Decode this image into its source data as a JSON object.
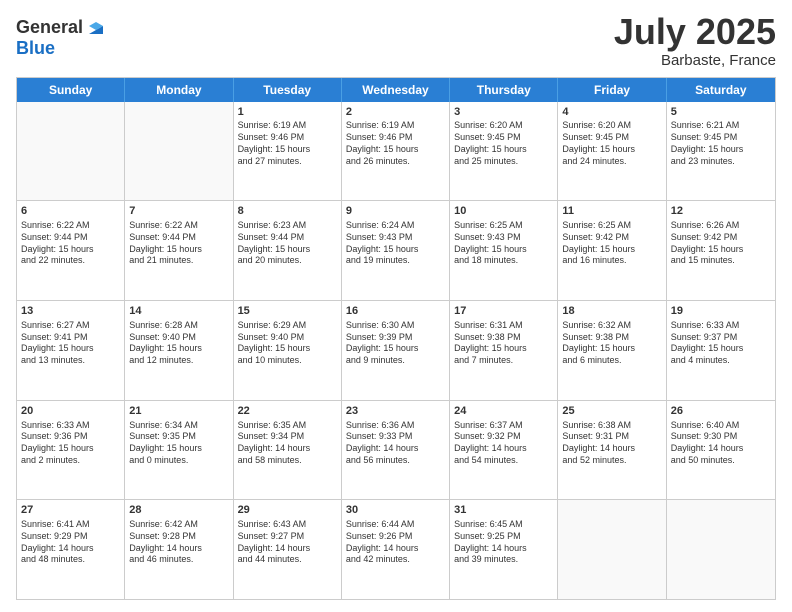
{
  "header": {
    "logo": {
      "line1": "General",
      "line2": "Blue"
    },
    "title": "July 2025",
    "subtitle": "Barbaste, France"
  },
  "weekdays": [
    "Sunday",
    "Monday",
    "Tuesday",
    "Wednesday",
    "Thursday",
    "Friday",
    "Saturday"
  ],
  "rows": [
    [
      {
        "day": "",
        "empty": true
      },
      {
        "day": "",
        "empty": true
      },
      {
        "day": "1",
        "l1": "Sunrise: 6:19 AM",
        "l2": "Sunset: 9:46 PM",
        "l3": "Daylight: 15 hours",
        "l4": "and 27 minutes."
      },
      {
        "day": "2",
        "l1": "Sunrise: 6:19 AM",
        "l2": "Sunset: 9:46 PM",
        "l3": "Daylight: 15 hours",
        "l4": "and 26 minutes."
      },
      {
        "day": "3",
        "l1": "Sunrise: 6:20 AM",
        "l2": "Sunset: 9:45 PM",
        "l3": "Daylight: 15 hours",
        "l4": "and 25 minutes."
      },
      {
        "day": "4",
        "l1": "Sunrise: 6:20 AM",
        "l2": "Sunset: 9:45 PM",
        "l3": "Daylight: 15 hours",
        "l4": "and 24 minutes."
      },
      {
        "day": "5",
        "l1": "Sunrise: 6:21 AM",
        "l2": "Sunset: 9:45 PM",
        "l3": "Daylight: 15 hours",
        "l4": "and 23 minutes."
      }
    ],
    [
      {
        "day": "6",
        "l1": "Sunrise: 6:22 AM",
        "l2": "Sunset: 9:44 PM",
        "l3": "Daylight: 15 hours",
        "l4": "and 22 minutes."
      },
      {
        "day": "7",
        "l1": "Sunrise: 6:22 AM",
        "l2": "Sunset: 9:44 PM",
        "l3": "Daylight: 15 hours",
        "l4": "and 21 minutes."
      },
      {
        "day": "8",
        "l1": "Sunrise: 6:23 AM",
        "l2": "Sunset: 9:44 PM",
        "l3": "Daylight: 15 hours",
        "l4": "and 20 minutes."
      },
      {
        "day": "9",
        "l1": "Sunrise: 6:24 AM",
        "l2": "Sunset: 9:43 PM",
        "l3": "Daylight: 15 hours",
        "l4": "and 19 minutes."
      },
      {
        "day": "10",
        "l1": "Sunrise: 6:25 AM",
        "l2": "Sunset: 9:43 PM",
        "l3": "Daylight: 15 hours",
        "l4": "and 18 minutes."
      },
      {
        "day": "11",
        "l1": "Sunrise: 6:25 AM",
        "l2": "Sunset: 9:42 PM",
        "l3": "Daylight: 15 hours",
        "l4": "and 16 minutes."
      },
      {
        "day": "12",
        "l1": "Sunrise: 6:26 AM",
        "l2": "Sunset: 9:42 PM",
        "l3": "Daylight: 15 hours",
        "l4": "and 15 minutes."
      }
    ],
    [
      {
        "day": "13",
        "l1": "Sunrise: 6:27 AM",
        "l2": "Sunset: 9:41 PM",
        "l3": "Daylight: 15 hours",
        "l4": "and 13 minutes."
      },
      {
        "day": "14",
        "l1": "Sunrise: 6:28 AM",
        "l2": "Sunset: 9:40 PM",
        "l3": "Daylight: 15 hours",
        "l4": "and 12 minutes."
      },
      {
        "day": "15",
        "l1": "Sunrise: 6:29 AM",
        "l2": "Sunset: 9:40 PM",
        "l3": "Daylight: 15 hours",
        "l4": "and 10 minutes."
      },
      {
        "day": "16",
        "l1": "Sunrise: 6:30 AM",
        "l2": "Sunset: 9:39 PM",
        "l3": "Daylight: 15 hours",
        "l4": "and 9 minutes."
      },
      {
        "day": "17",
        "l1": "Sunrise: 6:31 AM",
        "l2": "Sunset: 9:38 PM",
        "l3": "Daylight: 15 hours",
        "l4": "and 7 minutes."
      },
      {
        "day": "18",
        "l1": "Sunrise: 6:32 AM",
        "l2": "Sunset: 9:38 PM",
        "l3": "Daylight: 15 hours",
        "l4": "and 6 minutes."
      },
      {
        "day": "19",
        "l1": "Sunrise: 6:33 AM",
        "l2": "Sunset: 9:37 PM",
        "l3": "Daylight: 15 hours",
        "l4": "and 4 minutes."
      }
    ],
    [
      {
        "day": "20",
        "l1": "Sunrise: 6:33 AM",
        "l2": "Sunset: 9:36 PM",
        "l3": "Daylight: 15 hours",
        "l4": "and 2 minutes."
      },
      {
        "day": "21",
        "l1": "Sunrise: 6:34 AM",
        "l2": "Sunset: 9:35 PM",
        "l3": "Daylight: 15 hours",
        "l4": "and 0 minutes."
      },
      {
        "day": "22",
        "l1": "Sunrise: 6:35 AM",
        "l2": "Sunset: 9:34 PM",
        "l3": "Daylight: 14 hours",
        "l4": "and 58 minutes."
      },
      {
        "day": "23",
        "l1": "Sunrise: 6:36 AM",
        "l2": "Sunset: 9:33 PM",
        "l3": "Daylight: 14 hours",
        "l4": "and 56 minutes."
      },
      {
        "day": "24",
        "l1": "Sunrise: 6:37 AM",
        "l2": "Sunset: 9:32 PM",
        "l3": "Daylight: 14 hours",
        "l4": "and 54 minutes."
      },
      {
        "day": "25",
        "l1": "Sunrise: 6:38 AM",
        "l2": "Sunset: 9:31 PM",
        "l3": "Daylight: 14 hours",
        "l4": "and 52 minutes."
      },
      {
        "day": "26",
        "l1": "Sunrise: 6:40 AM",
        "l2": "Sunset: 9:30 PM",
        "l3": "Daylight: 14 hours",
        "l4": "and 50 minutes."
      }
    ],
    [
      {
        "day": "27",
        "l1": "Sunrise: 6:41 AM",
        "l2": "Sunset: 9:29 PM",
        "l3": "Daylight: 14 hours",
        "l4": "and 48 minutes."
      },
      {
        "day": "28",
        "l1": "Sunrise: 6:42 AM",
        "l2": "Sunset: 9:28 PM",
        "l3": "Daylight: 14 hours",
        "l4": "and 46 minutes."
      },
      {
        "day": "29",
        "l1": "Sunrise: 6:43 AM",
        "l2": "Sunset: 9:27 PM",
        "l3": "Daylight: 14 hours",
        "l4": "and 44 minutes."
      },
      {
        "day": "30",
        "l1": "Sunrise: 6:44 AM",
        "l2": "Sunset: 9:26 PM",
        "l3": "Daylight: 14 hours",
        "l4": "and 42 minutes."
      },
      {
        "day": "31",
        "l1": "Sunrise: 6:45 AM",
        "l2": "Sunset: 9:25 PM",
        "l3": "Daylight: 14 hours",
        "l4": "and 39 minutes."
      },
      {
        "day": "",
        "empty": true
      },
      {
        "day": "",
        "empty": true
      }
    ]
  ]
}
